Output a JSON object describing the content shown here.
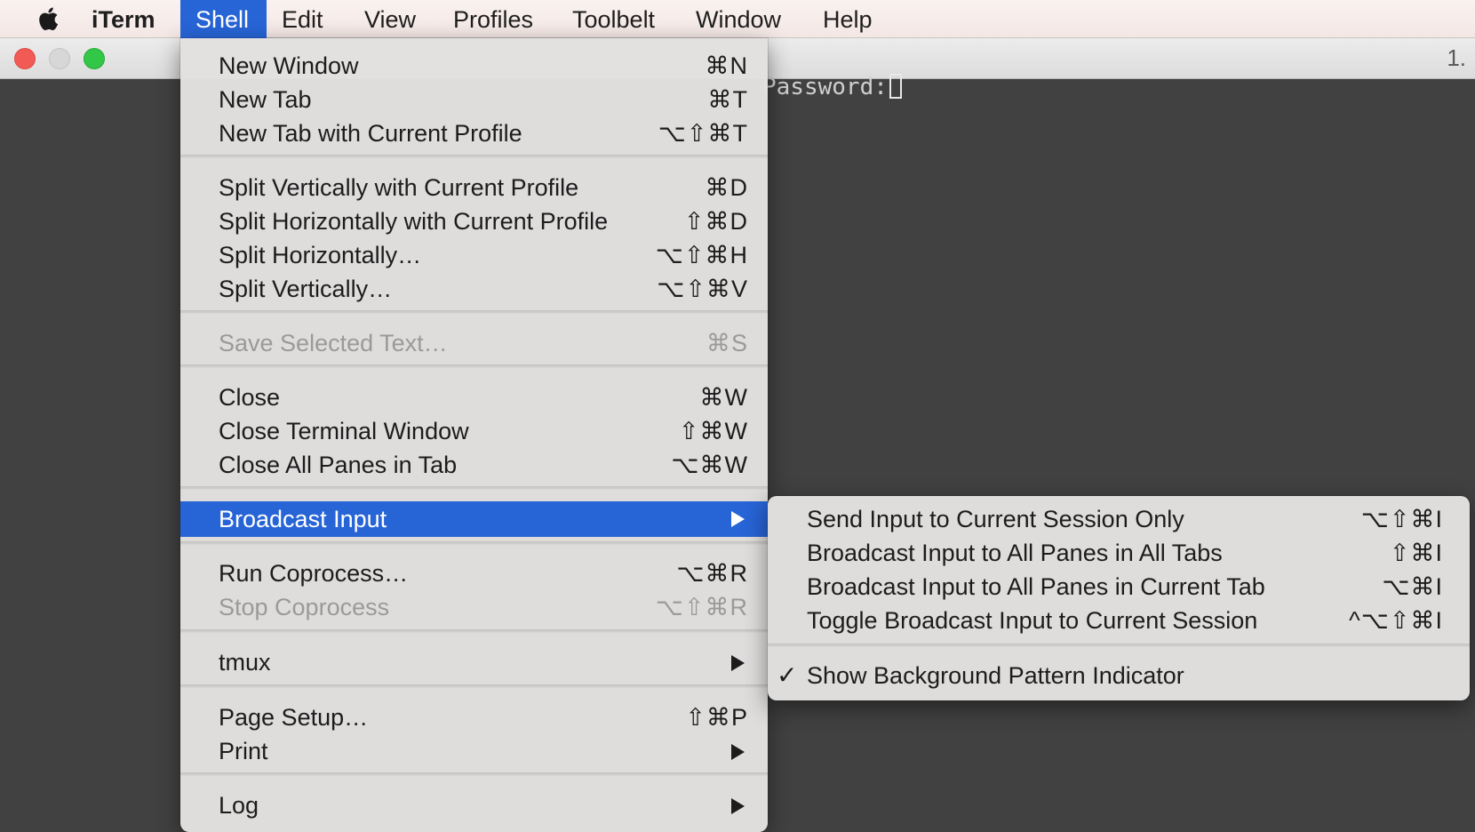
{
  "menubar": {
    "app_name": "iTerm",
    "items": [
      {
        "label": "Shell"
      },
      {
        "label": "Edit"
      },
      {
        "label": "View"
      },
      {
        "label": "Profiles"
      },
      {
        "label": "Toolbelt"
      },
      {
        "label": "Window"
      },
      {
        "label": "Help"
      }
    ]
  },
  "window": {
    "tab_number": "1.",
    "terminal_text": "Password:"
  },
  "shell_menu": {
    "items": [
      {
        "label": "New Window",
        "shortcut": "⌘N"
      },
      {
        "label": "New Tab",
        "shortcut": "⌘T"
      },
      {
        "label": "New Tab with Current Profile",
        "shortcut": "⌥⇧⌘T"
      },
      {
        "label": "Split Vertically with Current Profile",
        "shortcut": "⌘D"
      },
      {
        "label": "Split Horizontally with Current Profile",
        "shortcut": "⇧⌘D"
      },
      {
        "label": "Split Horizontally…",
        "shortcut": "⌥⇧⌘H"
      },
      {
        "label": "Split Vertically…",
        "shortcut": "⌥⇧⌘V"
      },
      {
        "label": "Save Selected Text…",
        "shortcut": "⌘S",
        "disabled": true
      },
      {
        "label": "Close",
        "shortcut": "⌘W"
      },
      {
        "label": "Close Terminal Window",
        "shortcut": "⇧⌘W"
      },
      {
        "label": "Close All Panes in Tab",
        "shortcut": "⌥⌘W"
      },
      {
        "label": "Broadcast Input",
        "submenu": true,
        "highlighted": true
      },
      {
        "label": "Run Coprocess…",
        "shortcut": "⌥⌘R"
      },
      {
        "label": "Stop Coprocess",
        "shortcut": "⌥⇧⌘R",
        "disabled": true
      },
      {
        "label": "tmux",
        "submenu": true
      },
      {
        "label": "Page Setup…",
        "shortcut": "⇧⌘P"
      },
      {
        "label": "Print",
        "submenu": true
      },
      {
        "label": "Log",
        "submenu": true
      }
    ]
  },
  "broadcast_submenu": {
    "items": [
      {
        "label": "Send Input to Current Session Only",
        "shortcut": "⌥⇧⌘I"
      },
      {
        "label": "Broadcast Input to All Panes in All Tabs",
        "shortcut": "⇧⌘I"
      },
      {
        "label": "Broadcast Input to All Panes in Current Tab",
        "shortcut": "⌥⌘I"
      },
      {
        "label": "Toggle Broadcast Input to Current Session",
        "shortcut": "^⌥⇧⌘I"
      },
      {
        "label": "Show Background Pattern Indicator",
        "checked": true,
        "check_mark": "✓"
      }
    ]
  },
  "colors": {
    "highlight": "#2764d6",
    "menu_background": "#e2e0df",
    "terminal_background": "#414141",
    "disabled_text": "#9a9a9a"
  },
  "icons": {
    "apple": "apple-logo-icon",
    "submenu_arrow": "chevron-right-icon",
    "check": "check-mark-icon"
  }
}
